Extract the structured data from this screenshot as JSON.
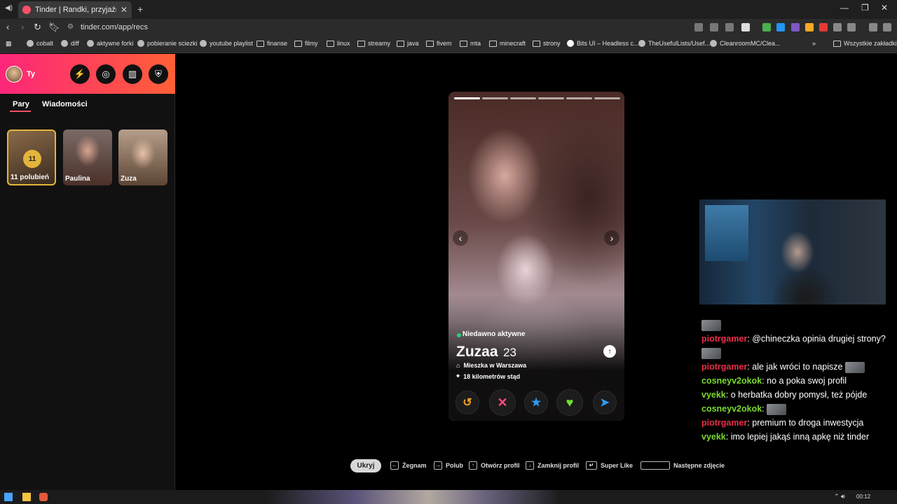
{
  "browser": {
    "tab_title": "Tinder | Randki, przyjaźni, nowe z",
    "url": "tinder.com/app/recs",
    "bookmarks": [
      "cobalt",
      "diff",
      "aktywne forki",
      "pobieranie sciezki",
      "youtube playlist",
      "finanse",
      "filmy",
      "linux",
      "streamy",
      "java",
      "fivem",
      "mta",
      "minecraft",
      "strony",
      "Bits UI – Headless c...",
      "TheUsefulLists/Usef...",
      "CleanroomMC/Clea..."
    ],
    "all_bookmarks": "Wszystkie zakładki",
    "more": "»"
  },
  "sidebar": {
    "user": "Ty",
    "tabs": [
      "Pary",
      "Wiadomości"
    ],
    "likes_count": "11",
    "likes_label": "11 polubień",
    "matches": [
      "Paulina",
      "Zuza"
    ]
  },
  "card": {
    "status": "Niedawno aktywne",
    "name": "Zuzaa",
    "age": "23",
    "lives": "Mieszka w Warszawa",
    "distance": "18 kilometrów stąd",
    "photo_count": 6,
    "active_photo": 1
  },
  "chat": [
    {
      "user": "",
      "color": "#e8304a",
      "text": "",
      "emote": true
    },
    {
      "user": "piotrgamer",
      "color": "#e8304a",
      "text": ": @chineczka opinia drugiej strony?",
      "emote": true
    },
    {
      "user": "piotrgamer",
      "color": "#e8304a",
      "text": ": ale jak wróci to napisze",
      "emote": true
    },
    {
      "user": "cosneyv2okok",
      "color": "#7bd92e",
      "text": ": no a poka swoj profil",
      "emote": false
    },
    {
      "user": "vyekk",
      "color": "#7bd92e",
      "text": ": o herbatka dobry pomysł, też pójde",
      "emote": false
    },
    {
      "user": "cosneyv2okok",
      "color": "#7bd92e",
      "text": ":",
      "emote": true
    },
    {
      "user": "piotrgamer",
      "color": "#e8304a",
      "text": ": premium to droga inwestycja",
      "emote": false
    },
    {
      "user": "vyekk",
      "color": "#7bd92e",
      "text": ": imo lepiej jakąś inną apkę niż tinder",
      "emote": false
    }
  ],
  "shortcuts": {
    "hide": "Ukryj",
    "nope": "Żegnam",
    "like": "Polub",
    "open_profile": "Otwórz profil",
    "close_profile": "Zamknij profil",
    "super_like": "Super Like",
    "next_photo": "Następne zdjęcie"
  },
  "taskbar": {
    "clock": "00:12"
  },
  "colors": {
    "brand_start": "#fd267a",
    "brand_end": "#ff6036",
    "like_green": "#6ee32f",
    "nope_pink": "#ff4b7d",
    "super_blue": "#2f9bf5",
    "rewind_gold": "#f5a623"
  }
}
